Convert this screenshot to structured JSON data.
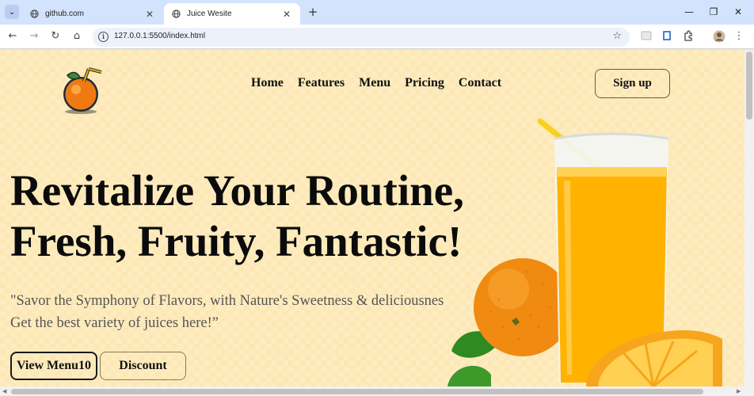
{
  "browser": {
    "tabs": [
      {
        "title": "github.com",
        "active": false
      },
      {
        "title": "Juice Wesite",
        "active": true
      }
    ],
    "url": "127.0.0.1:5500/index.html"
  },
  "site": {
    "nav": [
      "Home",
      "Features",
      "Menu",
      "Pricing",
      "Contact"
    ],
    "signup_label": "Sign up",
    "hero": {
      "title_line1": "Revitalize Your Routine,",
      "title_line2": "Fresh, Fruity, Fantastic!",
      "subtitle_line1": "\"Savor the Symphony of Flavors, with Nature's Sweetness & deliciousnes",
      "subtitle_line2": "Get the best variety of juices here!”",
      "btn_menu": "View Menu10",
      "btn_discount": "Discount"
    }
  },
  "colors": {
    "page_bg": "#fde8b4",
    "juice": "#ffb300",
    "orange": "#f08a10",
    "chrome_tabstrip": "#d3e3fd"
  },
  "icons": {
    "tab_search": "chevron-down-icon",
    "favicon": "globe-icon",
    "nav": [
      "back-arrow-icon",
      "forward-arrow-icon",
      "reload-icon",
      "home-icon"
    ],
    "omnibox": [
      "site-info-icon",
      "bookmark-star-icon"
    ],
    "extensions": [
      "extension-icon-1",
      "extension-icon-2",
      "puzzle-icon",
      "profile-avatar-icon",
      "kebab-menu-icon"
    ]
  }
}
